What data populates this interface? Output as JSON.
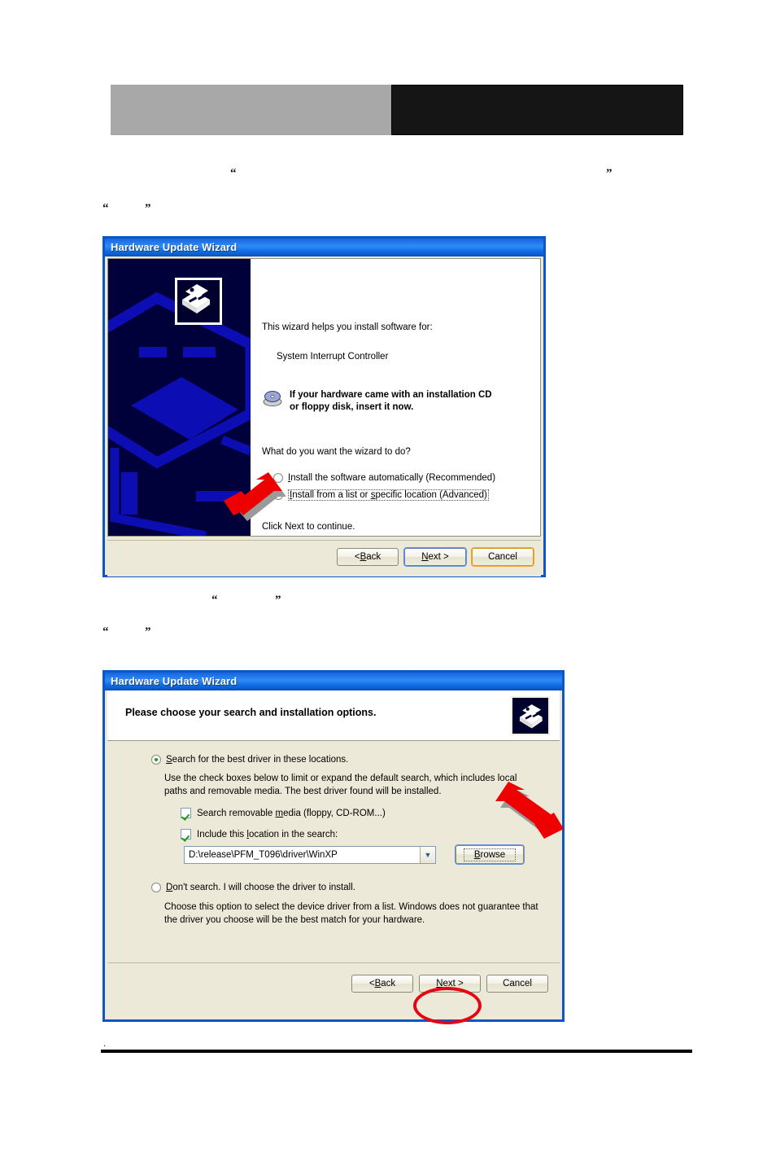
{
  "page": {
    "banner": {
      "left_block": "",
      "right_block": ""
    },
    "footer": {
      "dot": ".",
      "rule": ""
    }
  },
  "paragraphs": [
    {
      "id": "p1-open",
      "text": "“"
    },
    {
      "id": "p1-close",
      "text": "”"
    },
    {
      "id": "p2-open",
      "text": "“"
    },
    {
      "id": "p2-close",
      "text": "”"
    },
    {
      "id": "p3-open",
      "text": "“"
    },
    {
      "id": "p3-close",
      "text": "”"
    },
    {
      "id": "p4-open",
      "text": "“"
    },
    {
      "id": "p4-close",
      "text": "”"
    }
  ],
  "dialog1": {
    "title": "Hardware Update Wizard",
    "intro": "This wizard helps you install software for:",
    "device": "System Interrupt Controller",
    "cd_notice": "If your hardware came with an installation CD or floppy disk, insert it now.",
    "cd_notice_line1": "If your hardware came with an installation CD",
    "cd_notice_line2": "or floppy disk, insert it now.",
    "question": "What do you want the wizard to do?",
    "options": [
      {
        "label": "Install the software automatically (Recommended)",
        "selected": false
      },
      {
        "label": "Install from a list or specific location (Advanced)",
        "selected": true
      }
    ],
    "hint": "Click Next to continue.",
    "buttons": [
      {
        "label": "< Back",
        "state": "normal"
      },
      {
        "label": "Next >",
        "state": "default"
      },
      {
        "label": "Cancel",
        "state": "focused"
      }
    ]
  },
  "dialog2": {
    "title": "Hardware Update Wizard",
    "heading": "Please choose your search and installation options.",
    "option_search": {
      "label": "Search for the best driver in these locations.",
      "selected": true
    },
    "search_help_line1": "Use the check boxes below to limit or expand the default search, which includes local",
    "search_help_line2": "paths and removable media. The best driver found will be installed.",
    "checkboxes": [
      {
        "label": "Search removable media (floppy, CD-ROM...)",
        "checked": true
      },
      {
        "label": "Include this location in the search:",
        "checked": true
      }
    ],
    "location_combo": {
      "value": "D:\\release\\PFM_T096\\driver\\WinXP",
      "arrow": "▼"
    },
    "browse_button": "Browse",
    "option_dont_search": {
      "label": "Don't search. I will choose the driver to install.",
      "selected": false
    },
    "dont_search_help_line1": "Choose this option to select the device driver from a list.  Windows does not guarantee that",
    "dont_search_help_line2": "the driver you choose will be the best match for your hardware.",
    "buttons": [
      {
        "label": "< Back",
        "state": "normal"
      },
      {
        "label": "Next >",
        "state": "normal"
      },
      {
        "label": "Cancel",
        "state": "normal"
      }
    ]
  },
  "annotations": {
    "arrow1": "red-arrow-pointing-to-advanced-option",
    "arrow2": "red-arrow-pointing-to-browse-button",
    "ellipse": "red-ellipse-around-next-button"
  },
  "colors": {
    "titlebar_blue": "#1b70e8",
    "dialog_face": "#ece9d8",
    "annotation_red": "#e30613",
    "wizard_panel_navy": "#00003a",
    "banner_gray": "#a8a8a8",
    "banner_black": "#151515"
  }
}
